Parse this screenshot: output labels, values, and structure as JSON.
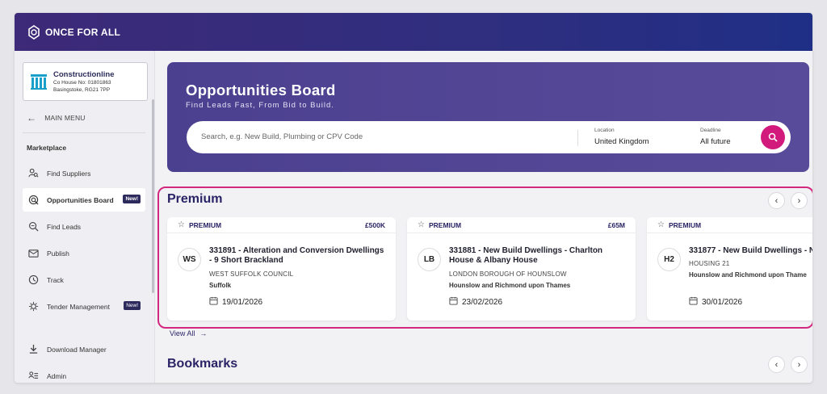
{
  "topbar": {
    "brand": "ONCE FOR ALL"
  },
  "company": {
    "name": "Constructionline",
    "house": "Co House No: 01801863",
    "address": "Basingstoke, RG21 7PP"
  },
  "sidebar": {
    "main_menu": "MAIN MENU",
    "section": "Marketplace",
    "items": [
      {
        "label": "Find Suppliers",
        "icon": "find-suppliers-icon"
      },
      {
        "label": "Opportunities Board",
        "icon": "opportunities-icon",
        "badge": "New!"
      },
      {
        "label": "Find Leads",
        "icon": "search-icon"
      },
      {
        "label": "Publish",
        "icon": "publish-icon"
      },
      {
        "label": "Track",
        "icon": "track-icon"
      },
      {
        "label": "Tender Management",
        "icon": "tender-icon",
        "badge": "New!"
      },
      {
        "label": "Download Manager",
        "icon": "download-icon"
      },
      {
        "label": "Admin",
        "icon": "admin-icon"
      }
    ]
  },
  "hero": {
    "title": "Opportunities Board",
    "tagline": "Find Leads Fast, From Bid to Build.",
    "search_placeholder": "Search, e.g. New Build, Plumbing or CPV Code",
    "location_label": "Location",
    "location_value": "United Kingdom",
    "deadline_label": "Deadline",
    "deadline_value": "All future"
  },
  "premium": {
    "title": "Premium",
    "view_all": "View All",
    "cards": [
      {
        "tier": "PREMIUM",
        "value": "£500K",
        "initials": "WS",
        "title_line1": "331891 - Alteration and Conversion Dwellings",
        "title_line2": "- 9 Short Brackland",
        "buyer": "WEST SUFFOLK COUNCIL",
        "location": "Suffolk",
        "date": "19/01/2026"
      },
      {
        "tier": "PREMIUM",
        "value": "£65M",
        "initials": "LB",
        "title_line1": "331881 - New Build Dwellings - Charlton",
        "title_line2": "House & Albany House",
        "buyer": "LONDON BOROUGH OF HOUNSLOW",
        "location": "Hounslow and Richmond upon Thames",
        "date": "23/02/2026"
      },
      {
        "tier": "PREMIUM",
        "value": "",
        "initials": "H2",
        "title_line1": "331877 - New Build Dwellings - N",
        "title_line2": "",
        "buyer": "HOUSING 21",
        "location": "Hounslow and Richmond upon Thame",
        "date": "30/01/2026"
      }
    ]
  },
  "bookmarks": {
    "title": "Bookmarks"
  },
  "colors": {
    "accent": "#d21a7c",
    "brand": "#2a2466",
    "hero": "#4b3f8f"
  }
}
